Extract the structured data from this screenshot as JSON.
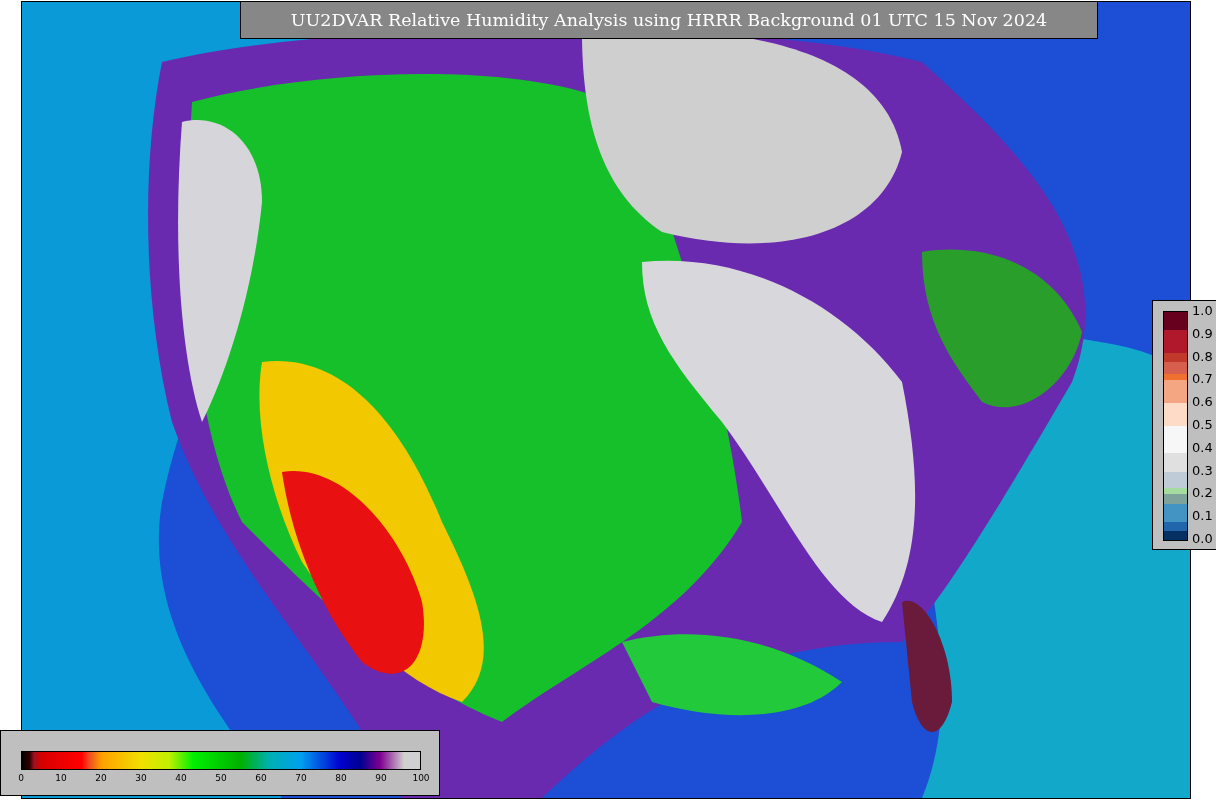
{
  "title": "UU2DVAR Relative Humidity Analysis using HRRR Background 01 UTC 15 Nov 2024",
  "station_colorbar": {
    "ticks": [
      "1.0",
      "0.9",
      "0.8",
      "0.7",
      "0.6",
      "0.5",
      "0.4",
      "0.3",
      "0.2",
      "0.1",
      "0.0"
    ]
  },
  "field_colorbar": {
    "ticks": [
      "0",
      "10",
      "20",
      "30",
      "40",
      "50",
      "60",
      "70",
      "80",
      "90",
      "100"
    ]
  }
}
